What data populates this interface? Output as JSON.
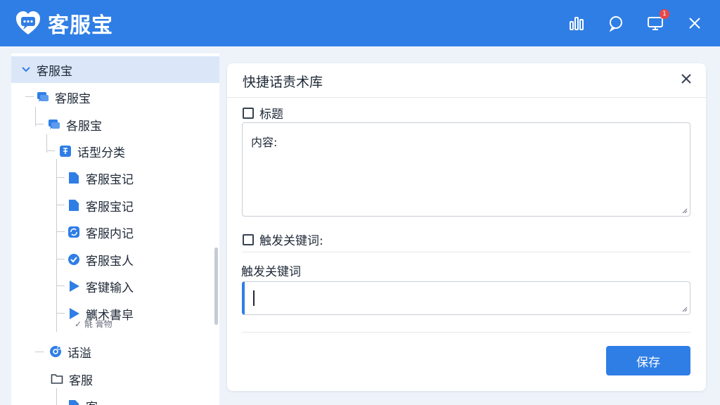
{
  "app": {
    "title": "客服宝",
    "notification_count": "1"
  },
  "colors": {
    "brand": "#2f7ee6",
    "selection": "#dbe7f8",
    "badge": "#e54848"
  },
  "header": {
    "icons": [
      "bar-chart-icon",
      "chat-bubble-icon",
      "monitor-icon",
      "close-icon"
    ]
  },
  "sidebar": {
    "root": {
      "label": "客服宝",
      "icon": "chevron-down-icon"
    },
    "nodes": [
      {
        "label": "客服宝",
        "icon": "chat-icon"
      },
      {
        "label": "各服宝",
        "icon": "chat-icon"
      },
      {
        "label": "话型分类",
        "icon": "category-icon"
      },
      {
        "label": "客服宝记",
        "icon": "file-icon"
      },
      {
        "label": "客服宝记",
        "icon": "file-icon"
      },
      {
        "label": "客服内记",
        "icon": "refresh-icon"
      },
      {
        "label": "客服宝人",
        "icon": "check-circle-icon"
      },
      {
        "label": "客键输入",
        "icon": "play-icon"
      },
      {
        "label": "觽术書皁",
        "icon": "play-icon",
        "overlap": "✓ 毻 膏物"
      },
      {
        "label": "话溢",
        "icon": "settings-circle-icon"
      },
      {
        "label": "客服",
        "icon": "folder-icon"
      },
      {
        "label": "客",
        "icon": "file-icon"
      }
    ]
  },
  "dialog": {
    "title": "快捷话责术库",
    "title_checkbox_label": "标题",
    "content_label": "内容:",
    "trigger_checkbox_label": "触发关键词:",
    "keyword_field_label": "触发关键词",
    "keyword_value": "",
    "save_label": "保存"
  }
}
